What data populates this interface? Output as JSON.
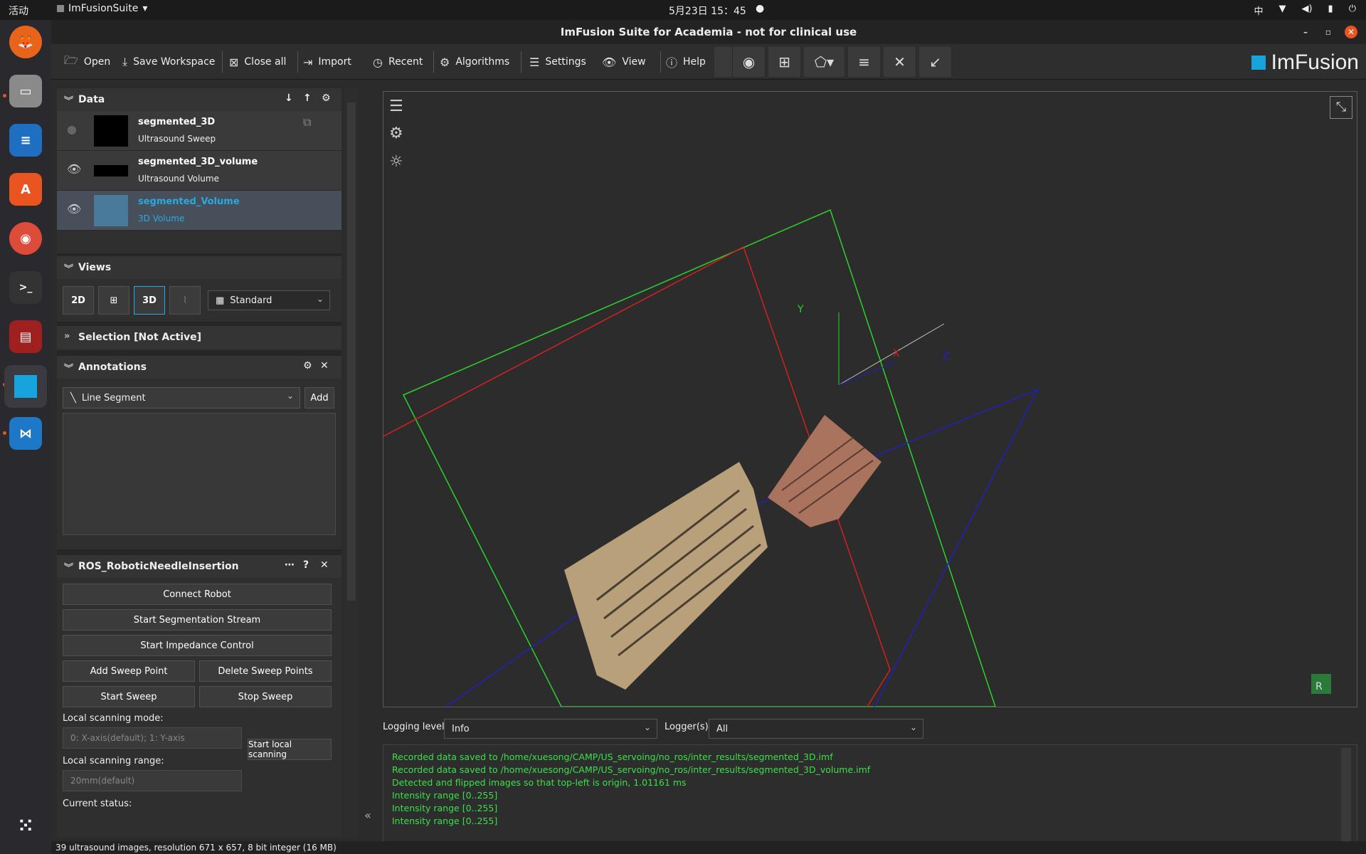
{
  "topbar": {
    "activities": "活动",
    "app": "ImFusionSuite",
    "clock": "5月23日  15：45",
    "ime": "中"
  },
  "window": {
    "title": "ImFusion Suite for Academia - not for clinical use"
  },
  "toolbar": {
    "open": "Open",
    "save": "Save Workspace",
    "close_all": "Close all",
    "import": "Import",
    "recent": "Recent",
    "algorithms": "Algorithms",
    "settings": "Settings",
    "view": "View",
    "help": "Help",
    "logo": "ImFusion"
  },
  "data_panel": {
    "title": "Data",
    "items": [
      {
        "name": "segmented_3D",
        "type": "Ultrasound Sweep"
      },
      {
        "name": "segmented_3D_volume",
        "type": "Ultrasound Volume"
      },
      {
        "name": "segmented_Volume",
        "type": "3D Volume"
      }
    ]
  },
  "views_panel": {
    "title": "Views",
    "btn2d": "2D",
    "btn3d": "3D",
    "layout": "Standard"
  },
  "selection_panel": {
    "title": "Selection [Not Active]"
  },
  "annotations_panel": {
    "title": "Annotations",
    "type": "Line Segment",
    "add": "Add"
  },
  "ros_panel": {
    "title": "ROS_RoboticNeedleInsertion",
    "connect": "Connect Robot",
    "seg_stream": "Start Segmentation Stream",
    "impedance": "Start Impedance Control",
    "add_sweep": "Add Sweep Point",
    "del_sweep": "Delete Sweep Points",
    "start_sweep": "Start Sweep",
    "stop_sweep": "Stop Sweep",
    "mode_label": "Local scanning mode:",
    "mode_placeholder": "0: X-axis(default); 1: Y-axis",
    "range_label": "Local scanning range:",
    "range_placeholder": "20mm(default)",
    "local_scan": "Start local scanning",
    "status_label": "Current status:"
  },
  "viewer": {
    "axis_x": "X",
    "axis_y": "Y",
    "axis_z": "Z",
    "cube_label": "R"
  },
  "logging": {
    "level_label": "Logging level",
    "level": "Info",
    "logger_label": "Logger(s)",
    "logger": "All",
    "lines": [
      "Recorded data saved to /home/xuesong/CAMP/US_servoing/no_ros/inter_results/segmented_3D.imf",
      "Recorded data saved to /home/xuesong/CAMP/US_servoing/no_ros/inter_results/segmented_3D_volume.imf",
      "Detected and flipped images so that top-left is origin, 1.01161 ms",
      "Intensity range [0..255]",
      "Intensity range [0..255]",
      "Intensity range [0..255]"
    ]
  },
  "status": {
    "text": "39 ultrasound images, resolution 671 x 657, 8 bit integer (16 MB)"
  },
  "colors": {
    "accent": "#17a3dc",
    "log": "#3ae04a"
  }
}
